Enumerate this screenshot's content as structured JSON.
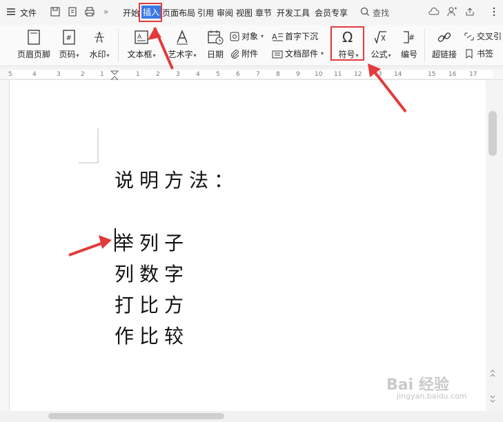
{
  "menubar": {
    "file": "文件",
    "tabs": [
      "开始",
      "插入",
      "页面布局",
      "引用",
      "审阅",
      "视图",
      "章节",
      "开发工具",
      "会员专享"
    ],
    "active_tab": "插入",
    "search": "查找"
  },
  "ribbon": {
    "header_footer": "页眉页脚",
    "page_number": "页码",
    "watermark": "水印",
    "textbox": "文本框",
    "wordart": "艺术字",
    "date": "日期",
    "object": "对象",
    "attachment": "附件",
    "dropcap": "首字下沉",
    "doc_parts": "文档部件",
    "symbol": "符号",
    "formula": "公式",
    "numbering": "编号",
    "hyperlink": "超链接",
    "crossref": "交叉引",
    "bookmark": "书签"
  },
  "ruler": {
    "ticks": [
      "5",
      "4",
      "3",
      "2",
      "1",
      "1",
      "2",
      "3",
      "4",
      "5",
      "6",
      "7",
      "8",
      "9",
      "10",
      "11",
      "12",
      "13",
      "14",
      "15",
      "16",
      "17"
    ]
  },
  "document": {
    "heading": "说明方法：",
    "lines": [
      "举列子",
      "列数字",
      "打比方",
      "作比较"
    ]
  },
  "watermark": {
    "main": "Bai 经验",
    "sub": "jingyan.baidu.com"
  },
  "colors": {
    "accent": "#3b78e7",
    "highlight_red": "#e23b3b"
  }
}
